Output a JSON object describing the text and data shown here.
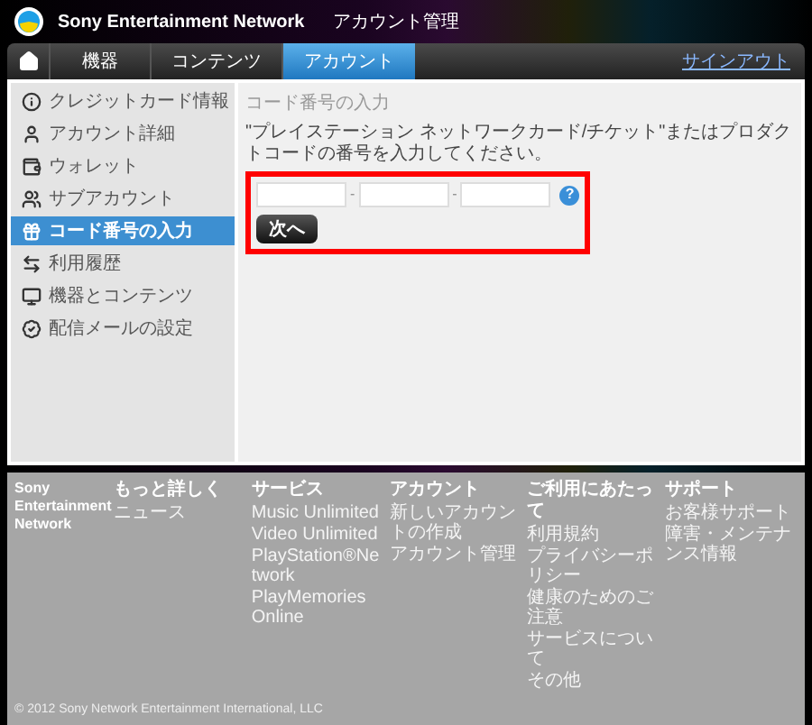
{
  "header": {
    "brand": "Sony Entertainment Network",
    "section": "アカウント管理"
  },
  "nav": {
    "tabs": [
      {
        "label": "機器",
        "selected": false
      },
      {
        "label": "コンテンツ",
        "selected": false
      },
      {
        "label": "アカウント",
        "selected": true
      }
    ],
    "signout": "サインアウト"
  },
  "sidebar": {
    "items": [
      {
        "label": "クレジットカード情報",
        "selected": false
      },
      {
        "label": "アカウント詳細",
        "selected": false
      },
      {
        "label": "ウォレット",
        "selected": false
      },
      {
        "label": "サブアカウント",
        "selected": false
      },
      {
        "label": "コード番号の入力",
        "selected": true
      },
      {
        "label": "利用履歴",
        "selected": false
      },
      {
        "label": "機器とコンテンツ",
        "selected": false
      },
      {
        "label": "配信メールの設定",
        "selected": false
      }
    ]
  },
  "content": {
    "title": "コード番号の入力",
    "description": "\"プレイステーション ネットワークカード/チケット\"またはプロダクトコードの番号を入力してください。",
    "code_fields": [
      {
        "kind": "text"
      },
      {
        "kind": "text"
      },
      {
        "kind": "text"
      }
    ],
    "separators": [
      "-",
      "-"
    ],
    "help": "?",
    "next_button": "次へ"
  },
  "footer": {
    "brand": "Sony Entertainment Network",
    "columns": [
      {
        "heading": "もっと詳しく",
        "links": [
          "ニュース"
        ]
      },
      {
        "heading": "サービス",
        "links": [
          "Music Unlimited",
          "Video Unlimited",
          "PlayStation®Network",
          "PlayMemories Online"
        ]
      },
      {
        "heading": "アカウント",
        "links": [
          "新しいアカウントの作成",
          "アカウント管理"
        ]
      },
      {
        "heading": "ご利用にあたって",
        "links": [
          "利用規約",
          "プライバシーポリシー",
          "健康のためのご注意",
          "サービスについて",
          "その他"
        ]
      },
      {
        "heading": "サポート",
        "links": [
          "お客様サポート",
          "障害・メンテナンス情報"
        ]
      }
    ],
    "copyright": "© 2012 Sony Network Entertainment International, LLC"
  }
}
